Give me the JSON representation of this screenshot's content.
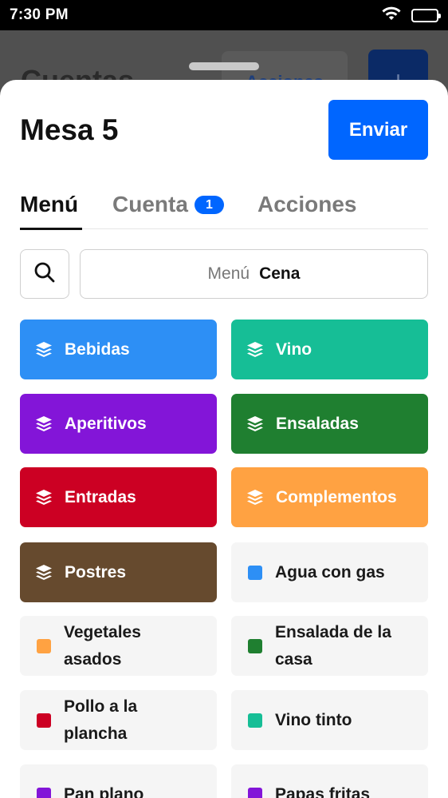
{
  "status_bar": {
    "time": "7:30 PM"
  },
  "background": {
    "title": "Cuentas",
    "actions_label": "Acciones",
    "add_label": "+"
  },
  "sheet": {
    "title": "Mesa 5",
    "send_label": "Enviar",
    "tabs": [
      {
        "label": "Menú",
        "active": true
      },
      {
        "label": "Cuenta",
        "badge": "1"
      },
      {
        "label": "Acciones"
      }
    ],
    "menu_select": {
      "label": "Menú",
      "value": "Cena"
    }
  },
  "categories": [
    {
      "label": "Bebidas",
      "color": "#2d8ff5"
    },
    {
      "label": "Vino",
      "color": "#16be96"
    },
    {
      "label": "Aperitivos",
      "color": "#8315d8"
    },
    {
      "label": "Ensaladas",
      "color": "#1f7f30"
    },
    {
      "label": "Entradas",
      "color": "#cc0023"
    },
    {
      "label": "Complementos",
      "color": "#ffa242"
    },
    {
      "label": "Postres",
      "color": "#664a2e"
    }
  ],
  "items": [
    {
      "label": "Agua con gas",
      "color": "#2d8ff5"
    },
    {
      "label_line1": "Vegetales",
      "label_line2": "asados",
      "color": "#ffa242"
    },
    {
      "label_line1": "Ensalada de la",
      "label_line2": "casa",
      "color": "#1f7f30"
    },
    {
      "label_line1": "Pollo a la",
      "label_line2": "plancha",
      "color": "#cc0023"
    },
    {
      "label": "Vino tinto",
      "color": "#16be96"
    },
    {
      "label": "Pan plano",
      "color": "#8315d8"
    },
    {
      "label": "Papas fritas",
      "color": "#8315d8"
    }
  ]
}
